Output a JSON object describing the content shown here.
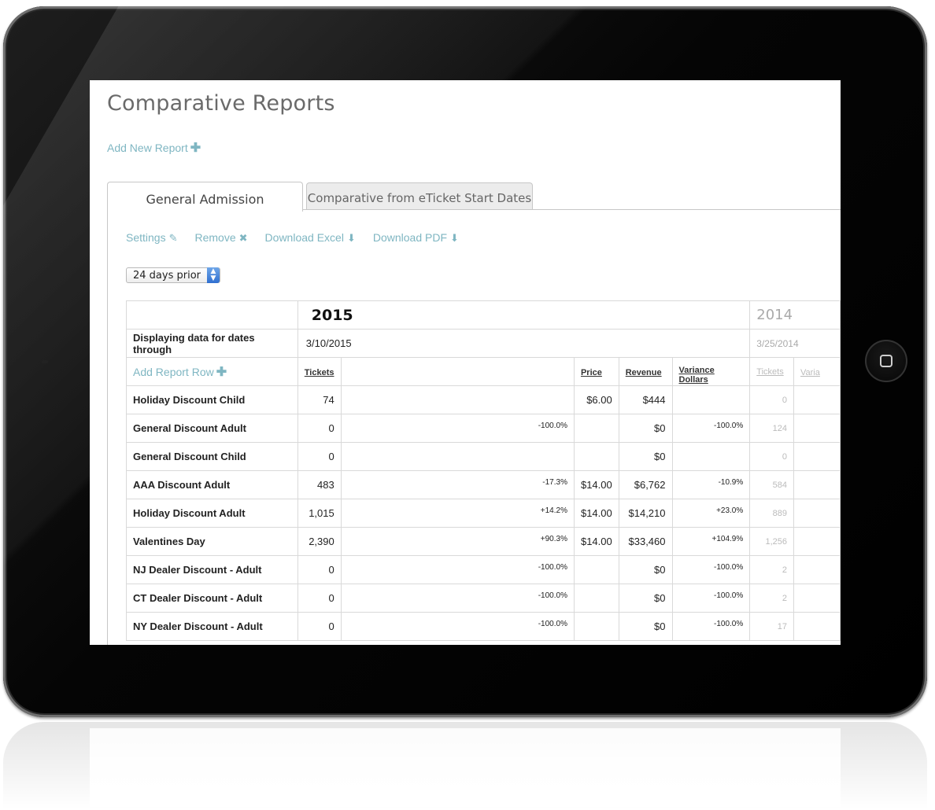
{
  "page": {
    "title": "Comparative Reports",
    "add_report_label": "Add New Report"
  },
  "tabs": [
    {
      "label": "General Admission",
      "active": true
    },
    {
      "label": "Comparative from eTicket Start Dates",
      "active": false
    }
  ],
  "actions": {
    "settings": "Settings",
    "remove": "Remove",
    "download_excel": "Download Excel",
    "download_pdf": "Download PDF"
  },
  "filter": {
    "selected": "24 days prior"
  },
  "table": {
    "year_current": "2015",
    "year_previous": "2014",
    "dates_label": "Displaying data for dates through",
    "date_current": "3/10/2015",
    "date_previous": "3/25/2014",
    "add_row_label": "Add Report Row",
    "headers": {
      "tickets": "Tickets",
      "price": "Price",
      "revenue": "Revenue",
      "variance_dollars": "Variance Dollars",
      "tickets_prev": "Tickets",
      "variance_prev": "Varia"
    },
    "rows": [
      {
        "label": "Holiday Discount Child",
        "tickets": "74",
        "pct": "",
        "price": "$6.00",
        "revenue": "$444",
        "variance": "",
        "tickets_prev": "0"
      },
      {
        "label": "General Discount Adult",
        "tickets": "0",
        "pct": "-100.0%",
        "price": "",
        "revenue": "$0",
        "variance": "-100.0%",
        "tickets_prev": "124"
      },
      {
        "label": "General Discount Child",
        "tickets": "0",
        "pct": "",
        "price": "",
        "revenue": "$0",
        "variance": "",
        "tickets_prev": "0"
      },
      {
        "label": "AAA Discount Adult",
        "tickets": "483",
        "pct": "-17.3%",
        "price": "$14.00",
        "revenue": "$6,762",
        "variance": "-10.9%",
        "tickets_prev": "584"
      },
      {
        "label": "Holiday Discount Adult",
        "tickets": "1,015",
        "pct": "+14.2%",
        "price": "$14.00",
        "revenue": "$14,210",
        "variance": "+23.0%",
        "tickets_prev": "889"
      },
      {
        "label": "Valentines Day",
        "tickets": "2,390",
        "pct": "+90.3%",
        "price": "$14.00",
        "revenue": "$33,460",
        "variance": "+104.9%",
        "tickets_prev": "1,256"
      },
      {
        "label": "NJ Dealer Discount - Adult",
        "tickets": "0",
        "pct": "-100.0%",
        "price": "",
        "revenue": "$0",
        "variance": "-100.0%",
        "tickets_prev": "2"
      },
      {
        "label": "CT Dealer Discount - Adult",
        "tickets": "0",
        "pct": "-100.0%",
        "price": "",
        "revenue": "$0",
        "variance": "-100.0%",
        "tickets_prev": "2"
      },
      {
        "label": "NY Dealer Discount - Adult",
        "tickets": "0",
        "pct": "-100.0%",
        "price": "",
        "revenue": "$0",
        "variance": "-100.0%",
        "tickets_prev": "17"
      }
    ]
  }
}
